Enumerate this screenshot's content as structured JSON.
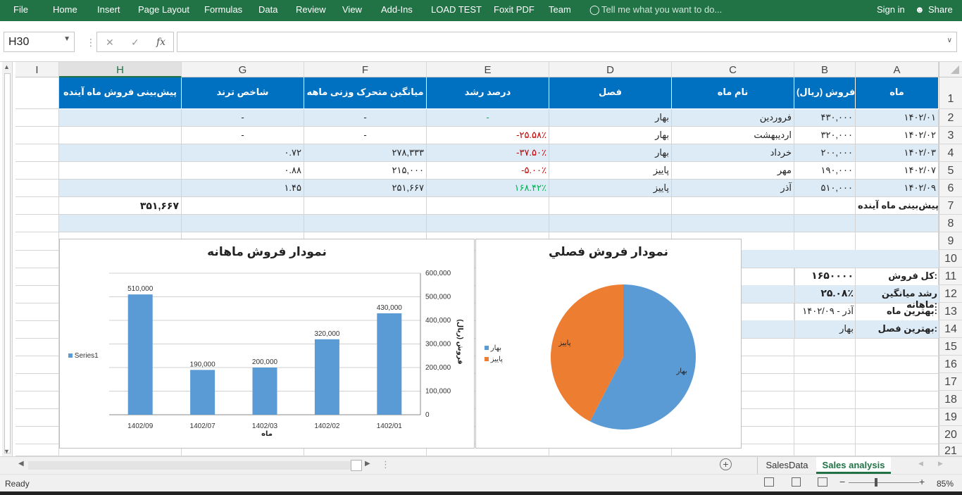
{
  "ribbon": {
    "file": "File",
    "tabs": [
      "Home",
      "Insert",
      "Page Layout",
      "Formulas",
      "Data",
      "Review",
      "View",
      "Add-Ins",
      "LOAD TEST",
      "Foxit PDF",
      "Team"
    ],
    "tell_me": "Tell me what you want to do...",
    "sign_in": "Sign in",
    "share": "Share"
  },
  "formula_bar": {
    "name_box": "H30",
    "fx": "fx",
    "value": ""
  },
  "columns": [
    "I",
    "H",
    "G",
    "F",
    "E",
    "D",
    "C",
    "B",
    "A"
  ],
  "rows": [
    "1",
    "2",
    "3",
    "4",
    "5",
    "6",
    "7",
    "8",
    "9",
    "10",
    "11",
    "12",
    "13",
    "14",
    "15",
    "16",
    "17",
    "18",
    "19",
    "20",
    "21"
  ],
  "table": {
    "headers": {
      "a": "ماه",
      "b": "فروش (ریال)",
      "c": "نام ماه",
      "d": "فصل",
      "e": "درصد رشد",
      "f": "میانگین متحرک وزنی ماهه",
      "g": "شاخص ترند",
      "h": "پیش‌بینی فروش ماه آینده"
    },
    "data": [
      {
        "a": "۱۴۰۲/۰۱",
        "b": "۴۳۰,۰۰۰",
        "c": "فروردین",
        "d": "بهار",
        "e": "-",
        "f": "-",
        "g": "-"
      },
      {
        "a": "۱۴۰۲/۰۲",
        "b": "۳۲۰,۰۰۰",
        "c": "اردیبهشت",
        "d": "بهار",
        "e": "-۲۵.۵۸٪",
        "f": "-",
        "g": "-"
      },
      {
        "a": "۱۴۰۲/۰۳",
        "b": "۲۰۰,۰۰۰",
        "c": "خرداد",
        "d": "بهار",
        "e": "-۳۷.۵۰٪",
        "f": "۲۷۸,۳۳۳",
        "g": "۰.۷۲"
      },
      {
        "a": "۱۴۰۲/۰۷",
        "b": "۱۹۰,۰۰۰",
        "c": "مهر",
        "d": "پاییز",
        "e": "-۵.۰۰٪",
        "f": "۲۱۵,۰۰۰",
        "g": "۰.۸۸"
      },
      {
        "a": "۱۴۰۲/۰۹",
        "b": "۵۱۰,۰۰۰",
        "c": "آذر",
        "d": "پاییز",
        "e": "۱۶۸.۴۲٪",
        "f": "۲۵۱,۶۶۷",
        "g": "۱.۴۵"
      }
    ],
    "forecast_label": "پیش‌بینی ماه آینده",
    "forecast_value": "۳۵۱,۶۶۷"
  },
  "summary": {
    "total_label": "کل فروش:",
    "total_value": "۱۶۵۰۰۰۰",
    "growth_label": "رشد میانگین ماهانه:",
    "growth_value": "۲۵.۰۸٪",
    "best_month_label": "بهترین ماه:",
    "best_month_value": "آذر - ۱۴۰۲/۰۹",
    "best_season_label": "بهترین فصل:",
    "best_season_value": "بهار"
  },
  "colors": {
    "excel_green": "#217346",
    "header_blue": "#0070c0",
    "band": "#ddebf7",
    "bar": "#5b9bd5",
    "pie_orange": "#ed7d31",
    "neg": "#c00000",
    "pos": "#00b050"
  },
  "chart_data": [
    {
      "type": "bar",
      "title": "نمودار فروش ماهانه",
      "categories": [
        "1402/09",
        "1402/07",
        "1402/03",
        "1402/02",
        "1402/01"
      ],
      "series": [
        {
          "name": "Series1",
          "values": [
            510000,
            190000,
            200000,
            320000,
            430000
          ]
        }
      ],
      "data_labels": [
        "510,000",
        "190,000",
        "200,000",
        "320,000",
        "430,000"
      ],
      "xlabel": "ماه",
      "ylabel": "فروش (ریال)",
      "ylim": [
        0,
        600000
      ],
      "yticks": [
        "0",
        "100,000",
        "200,000",
        "300,000",
        "400,000",
        "500,000",
        "600,000"
      ],
      "grid": true,
      "legend": "left",
      "y_axis_side": "right"
    },
    {
      "type": "pie",
      "title": "نمودار فروش فصلي",
      "slices": [
        {
          "label": "بهار",
          "value": 950000
        },
        {
          "label": "پاییز",
          "value": 700000
        }
      ],
      "legend": [
        "بهار",
        "پاییز"
      ]
    }
  ],
  "sheet_tabs": [
    "SalesData",
    "Sales analysis"
  ],
  "status": {
    "ready": "Ready",
    "zoom": "85%"
  }
}
